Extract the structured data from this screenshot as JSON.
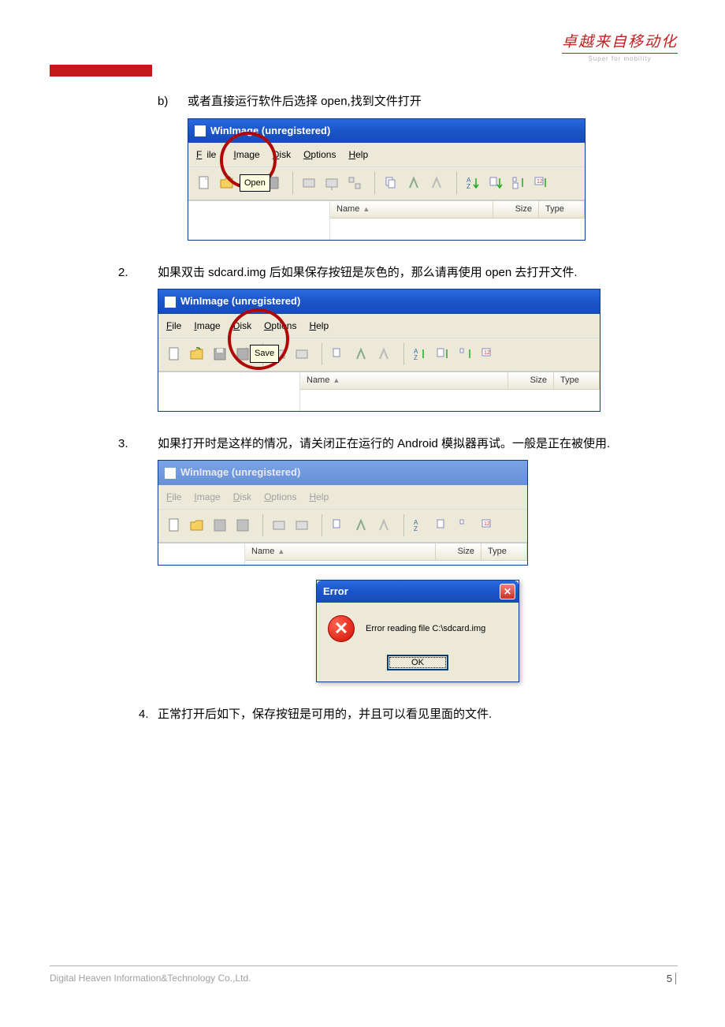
{
  "header": {
    "logo_text": "卓越来自移动化",
    "logo_sub": "Super for mobility"
  },
  "items": {
    "b_marker": "b)",
    "b_text": "或者直接运行软件后选择 open,找到文件打开",
    "i2_marker": "2.",
    "i2_text": "如果双击 sdcard.img 后如果保存按钮是灰色的，那么请再使用 open 去打开文件.",
    "i3_marker": "3.",
    "i3_text": "如果打开时是这样的情况，请关闭正在运行的 Android 模拟器再试。一般是正在被使用.",
    "i4_marker": "4.",
    "i4_text": "正常打开后如下，保存按钮是可用的，并且可以看见里面的文件."
  },
  "win": {
    "title": "WinImage (unregistered)",
    "menu_file": "File",
    "menu_image": "Image",
    "menu_disk": "Disk",
    "menu_options": "Options",
    "menu_help": "Help",
    "col_name": "Name",
    "col_size": "Size",
    "col_type": "Type",
    "tooltip_open": "Open",
    "tooltip_save": "Save"
  },
  "error": {
    "title": "Error",
    "message": "Error reading file C:\\sdcard.img",
    "ok": "OK"
  },
  "footer": {
    "company": "Digital Heaven Information&Technology Co.,Ltd.",
    "page": "5"
  }
}
